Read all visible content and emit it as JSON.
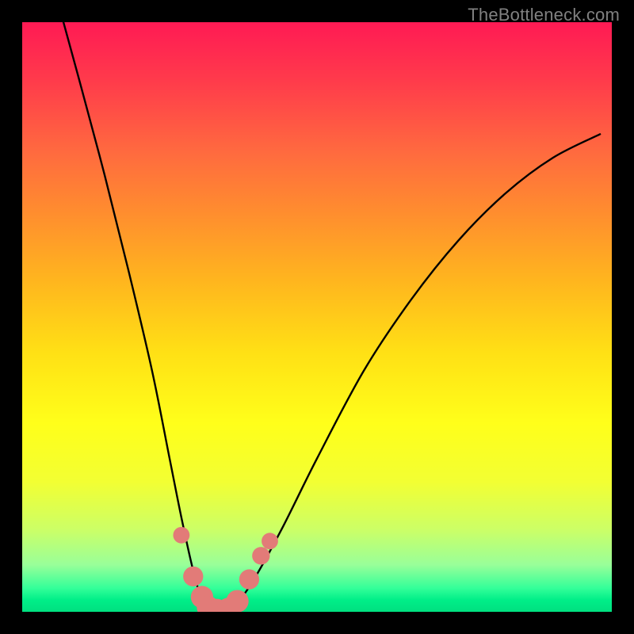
{
  "watermark": "TheBottleneck.com",
  "chart_data": {
    "type": "line",
    "title": "",
    "xlabel": "",
    "ylabel": "",
    "xlim": [
      0,
      100
    ],
    "ylim": [
      0,
      100
    ],
    "grid": false,
    "legend": false,
    "annotations": [],
    "series": [
      {
        "name": "curve",
        "x": [
          7,
          10,
          14,
          18,
          22,
          25,
          27,
          29,
          30.5,
          32,
          34,
          36,
          39,
          44,
          50,
          58,
          66,
          74,
          82,
          90,
          98
        ],
        "y": [
          100,
          89,
          74,
          58,
          41,
          26,
          16,
          7,
          2,
          0,
          0,
          1,
          5,
          14,
          26,
          41,
          53,
          63,
          71,
          77,
          81
        ]
      }
    ],
    "markers": {
      "name": "dots",
      "color": "#e27b78",
      "points": [
        {
          "x": 27.0,
          "y": 13.0,
          "r": 1.4
        },
        {
          "x": 29.0,
          "y": 6.0,
          "r": 1.7
        },
        {
          "x": 30.5,
          "y": 2.5,
          "r": 1.9
        },
        {
          "x": 31.5,
          "y": 0.8,
          "r": 1.9
        },
        {
          "x": 33.0,
          "y": 0.3,
          "r": 1.9
        },
        {
          "x": 35.0,
          "y": 0.5,
          "r": 1.9
        },
        {
          "x": 36.5,
          "y": 1.8,
          "r": 1.9
        },
        {
          "x": 38.5,
          "y": 5.5,
          "r": 1.7
        },
        {
          "x": 40.5,
          "y": 9.5,
          "r": 1.5
        },
        {
          "x": 42.0,
          "y": 12.0,
          "r": 1.4
        }
      ]
    }
  }
}
